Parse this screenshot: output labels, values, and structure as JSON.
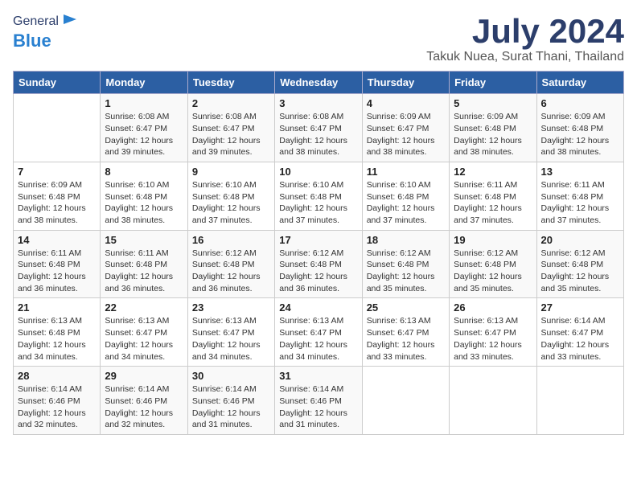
{
  "header": {
    "logo_general": "General",
    "logo_blue": "Blue",
    "month_year": "July 2024",
    "location": "Takuk Nuea, Surat Thani, Thailand"
  },
  "weekdays": [
    "Sunday",
    "Monday",
    "Tuesday",
    "Wednesday",
    "Thursday",
    "Friday",
    "Saturday"
  ],
  "weeks": [
    [
      {
        "day": "",
        "info": ""
      },
      {
        "day": "1",
        "info": "Sunrise: 6:08 AM\nSunset: 6:47 PM\nDaylight: 12 hours\nand 39 minutes."
      },
      {
        "day": "2",
        "info": "Sunrise: 6:08 AM\nSunset: 6:47 PM\nDaylight: 12 hours\nand 39 minutes."
      },
      {
        "day": "3",
        "info": "Sunrise: 6:08 AM\nSunset: 6:47 PM\nDaylight: 12 hours\nand 38 minutes."
      },
      {
        "day": "4",
        "info": "Sunrise: 6:09 AM\nSunset: 6:47 PM\nDaylight: 12 hours\nand 38 minutes."
      },
      {
        "day": "5",
        "info": "Sunrise: 6:09 AM\nSunset: 6:48 PM\nDaylight: 12 hours\nand 38 minutes."
      },
      {
        "day": "6",
        "info": "Sunrise: 6:09 AM\nSunset: 6:48 PM\nDaylight: 12 hours\nand 38 minutes."
      }
    ],
    [
      {
        "day": "7",
        "info": "Sunrise: 6:09 AM\nSunset: 6:48 PM\nDaylight: 12 hours\nand 38 minutes."
      },
      {
        "day": "8",
        "info": "Sunrise: 6:10 AM\nSunset: 6:48 PM\nDaylight: 12 hours\nand 38 minutes."
      },
      {
        "day": "9",
        "info": "Sunrise: 6:10 AM\nSunset: 6:48 PM\nDaylight: 12 hours\nand 37 minutes."
      },
      {
        "day": "10",
        "info": "Sunrise: 6:10 AM\nSunset: 6:48 PM\nDaylight: 12 hours\nand 37 minutes."
      },
      {
        "day": "11",
        "info": "Sunrise: 6:10 AM\nSunset: 6:48 PM\nDaylight: 12 hours\nand 37 minutes."
      },
      {
        "day": "12",
        "info": "Sunrise: 6:11 AM\nSunset: 6:48 PM\nDaylight: 12 hours\nand 37 minutes."
      },
      {
        "day": "13",
        "info": "Sunrise: 6:11 AM\nSunset: 6:48 PM\nDaylight: 12 hours\nand 37 minutes."
      }
    ],
    [
      {
        "day": "14",
        "info": "Sunrise: 6:11 AM\nSunset: 6:48 PM\nDaylight: 12 hours\nand 36 minutes."
      },
      {
        "day": "15",
        "info": "Sunrise: 6:11 AM\nSunset: 6:48 PM\nDaylight: 12 hours\nand 36 minutes."
      },
      {
        "day": "16",
        "info": "Sunrise: 6:12 AM\nSunset: 6:48 PM\nDaylight: 12 hours\nand 36 minutes."
      },
      {
        "day": "17",
        "info": "Sunrise: 6:12 AM\nSunset: 6:48 PM\nDaylight: 12 hours\nand 36 minutes."
      },
      {
        "day": "18",
        "info": "Sunrise: 6:12 AM\nSunset: 6:48 PM\nDaylight: 12 hours\nand 35 minutes."
      },
      {
        "day": "19",
        "info": "Sunrise: 6:12 AM\nSunset: 6:48 PM\nDaylight: 12 hours\nand 35 minutes."
      },
      {
        "day": "20",
        "info": "Sunrise: 6:12 AM\nSunset: 6:48 PM\nDaylight: 12 hours\nand 35 minutes."
      }
    ],
    [
      {
        "day": "21",
        "info": "Sunrise: 6:13 AM\nSunset: 6:48 PM\nDaylight: 12 hours\nand 34 minutes."
      },
      {
        "day": "22",
        "info": "Sunrise: 6:13 AM\nSunset: 6:47 PM\nDaylight: 12 hours\nand 34 minutes."
      },
      {
        "day": "23",
        "info": "Sunrise: 6:13 AM\nSunset: 6:47 PM\nDaylight: 12 hours\nand 34 minutes."
      },
      {
        "day": "24",
        "info": "Sunrise: 6:13 AM\nSunset: 6:47 PM\nDaylight: 12 hours\nand 34 minutes."
      },
      {
        "day": "25",
        "info": "Sunrise: 6:13 AM\nSunset: 6:47 PM\nDaylight: 12 hours\nand 33 minutes."
      },
      {
        "day": "26",
        "info": "Sunrise: 6:13 AM\nSunset: 6:47 PM\nDaylight: 12 hours\nand 33 minutes."
      },
      {
        "day": "27",
        "info": "Sunrise: 6:14 AM\nSunset: 6:47 PM\nDaylight: 12 hours\nand 33 minutes."
      }
    ],
    [
      {
        "day": "28",
        "info": "Sunrise: 6:14 AM\nSunset: 6:46 PM\nDaylight: 12 hours\nand 32 minutes."
      },
      {
        "day": "29",
        "info": "Sunrise: 6:14 AM\nSunset: 6:46 PM\nDaylight: 12 hours\nand 32 minutes."
      },
      {
        "day": "30",
        "info": "Sunrise: 6:14 AM\nSunset: 6:46 PM\nDaylight: 12 hours\nand 31 minutes."
      },
      {
        "day": "31",
        "info": "Sunrise: 6:14 AM\nSunset: 6:46 PM\nDaylight: 12 hours\nand 31 minutes."
      },
      {
        "day": "",
        "info": ""
      },
      {
        "day": "",
        "info": ""
      },
      {
        "day": "",
        "info": ""
      }
    ]
  ]
}
